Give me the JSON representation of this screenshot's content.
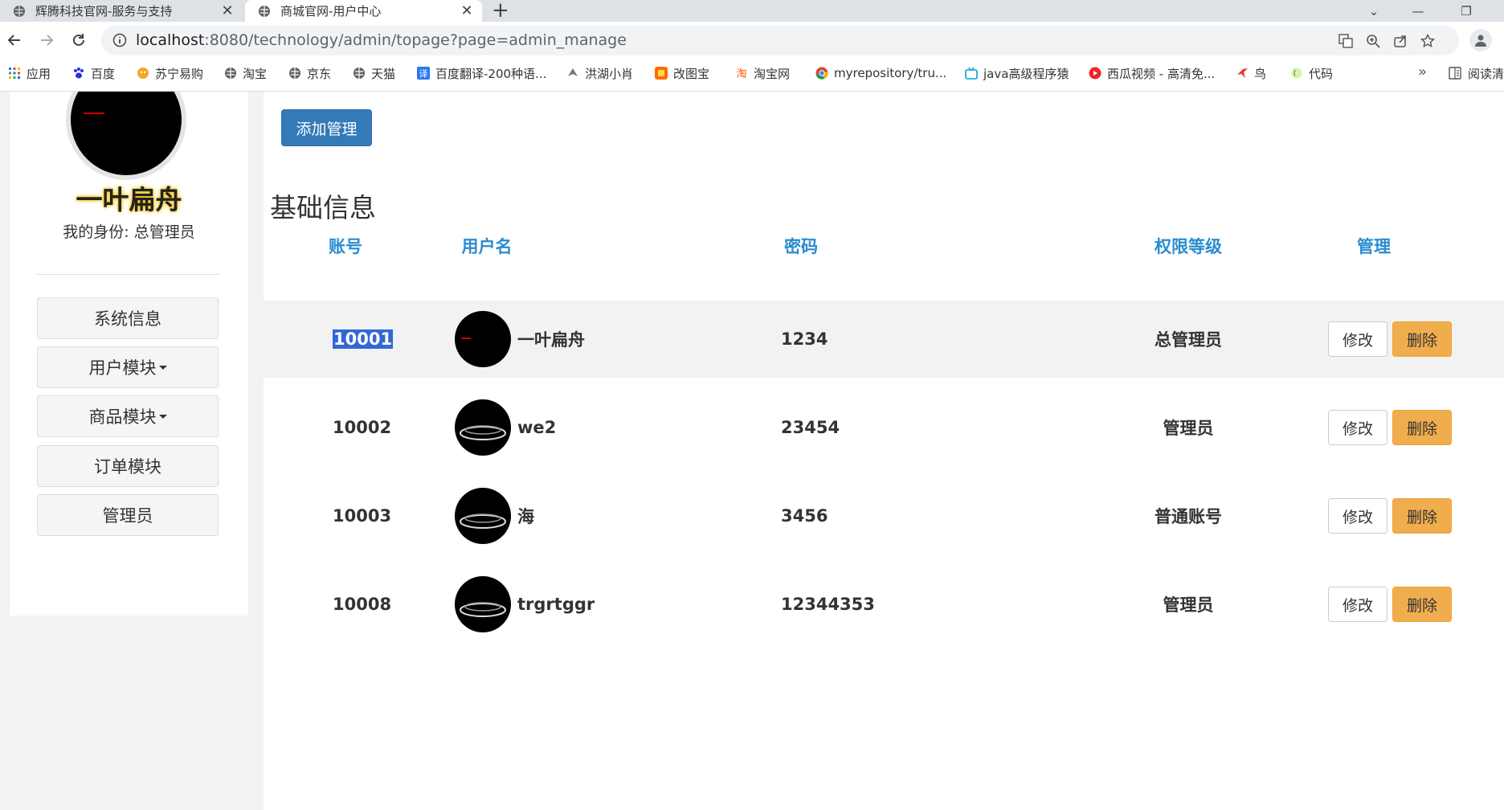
{
  "browser": {
    "tabs": [
      {
        "title": "辉腾科技官网-服务与支持",
        "active": false
      },
      {
        "title": "商城官网-用户中心",
        "active": true
      }
    ],
    "url_host": "localhost",
    "url_rest": ":8080/technology/admin/topage?page=admin_manage",
    "bookmarks": [
      {
        "label": "应用",
        "icon": "apps-grid-icon"
      },
      {
        "label": "百度",
        "icon": "baidu-paw-icon"
      },
      {
        "label": "苏宁易购",
        "icon": "suning-icon"
      },
      {
        "label": "淘宝",
        "icon": "globe-icon"
      },
      {
        "label": "京东",
        "icon": "globe-icon"
      },
      {
        "label": "天猫",
        "icon": "globe-icon"
      },
      {
        "label": "百度翻译-200种语...",
        "icon": "translate-icon"
      },
      {
        "label": "洪湖小肖",
        "icon": "bird-icon"
      },
      {
        "label": "改图宝",
        "icon": "image-tool-icon"
      },
      {
        "label": "淘宝网",
        "icon": "taobao-icon"
      },
      {
        "label": "myrepository/tru...",
        "icon": "chrome-icon"
      },
      {
        "label": "java高级程序猿",
        "icon": "bilibili-icon"
      },
      {
        "label": "西瓜视频 - 高清免...",
        "icon": "xigua-icon"
      },
      {
        "label": "鸟",
        "icon": "bird-red-icon"
      },
      {
        "label": "代码",
        "icon": "code-icon"
      }
    ],
    "reading_list": "阅读清",
    "more_bookmarks": "»"
  },
  "sidebar": {
    "nickname": "一叶扁舟",
    "identity": "我的身份: 总管理员",
    "menu": [
      {
        "label": "系统信息",
        "dropdown": false
      },
      {
        "label": "用户模块",
        "dropdown": true
      },
      {
        "label": "商品模块",
        "dropdown": true
      },
      {
        "label": "订单模块",
        "dropdown": false
      },
      {
        "label": "管理员",
        "dropdown": false
      }
    ]
  },
  "main": {
    "add_button": "添加管理",
    "section_title": "基础信息",
    "columns": [
      "账号",
      "用户名",
      "密码",
      "权限等级",
      "管理"
    ],
    "rows": [
      {
        "account": "10001",
        "username": "一叶扁舟",
        "password": "1234",
        "level": "总管理员"
      },
      {
        "account": "10002",
        "username": "we2",
        "password": "23454",
        "level": "管理员"
      },
      {
        "account": "10003",
        "username": "海",
        "password": "3456",
        "level": "普通账号"
      },
      {
        "account": "10008",
        "username": "trgrtggr",
        "password": "12344353",
        "level": "管理员"
      }
    ],
    "edit_label": "修改",
    "delete_label": "删除"
  },
  "colors": {
    "primary": "#337ab7",
    "warning": "#f0ad4e",
    "header_text": "#2a8ccf",
    "selection": "#3367d6"
  }
}
